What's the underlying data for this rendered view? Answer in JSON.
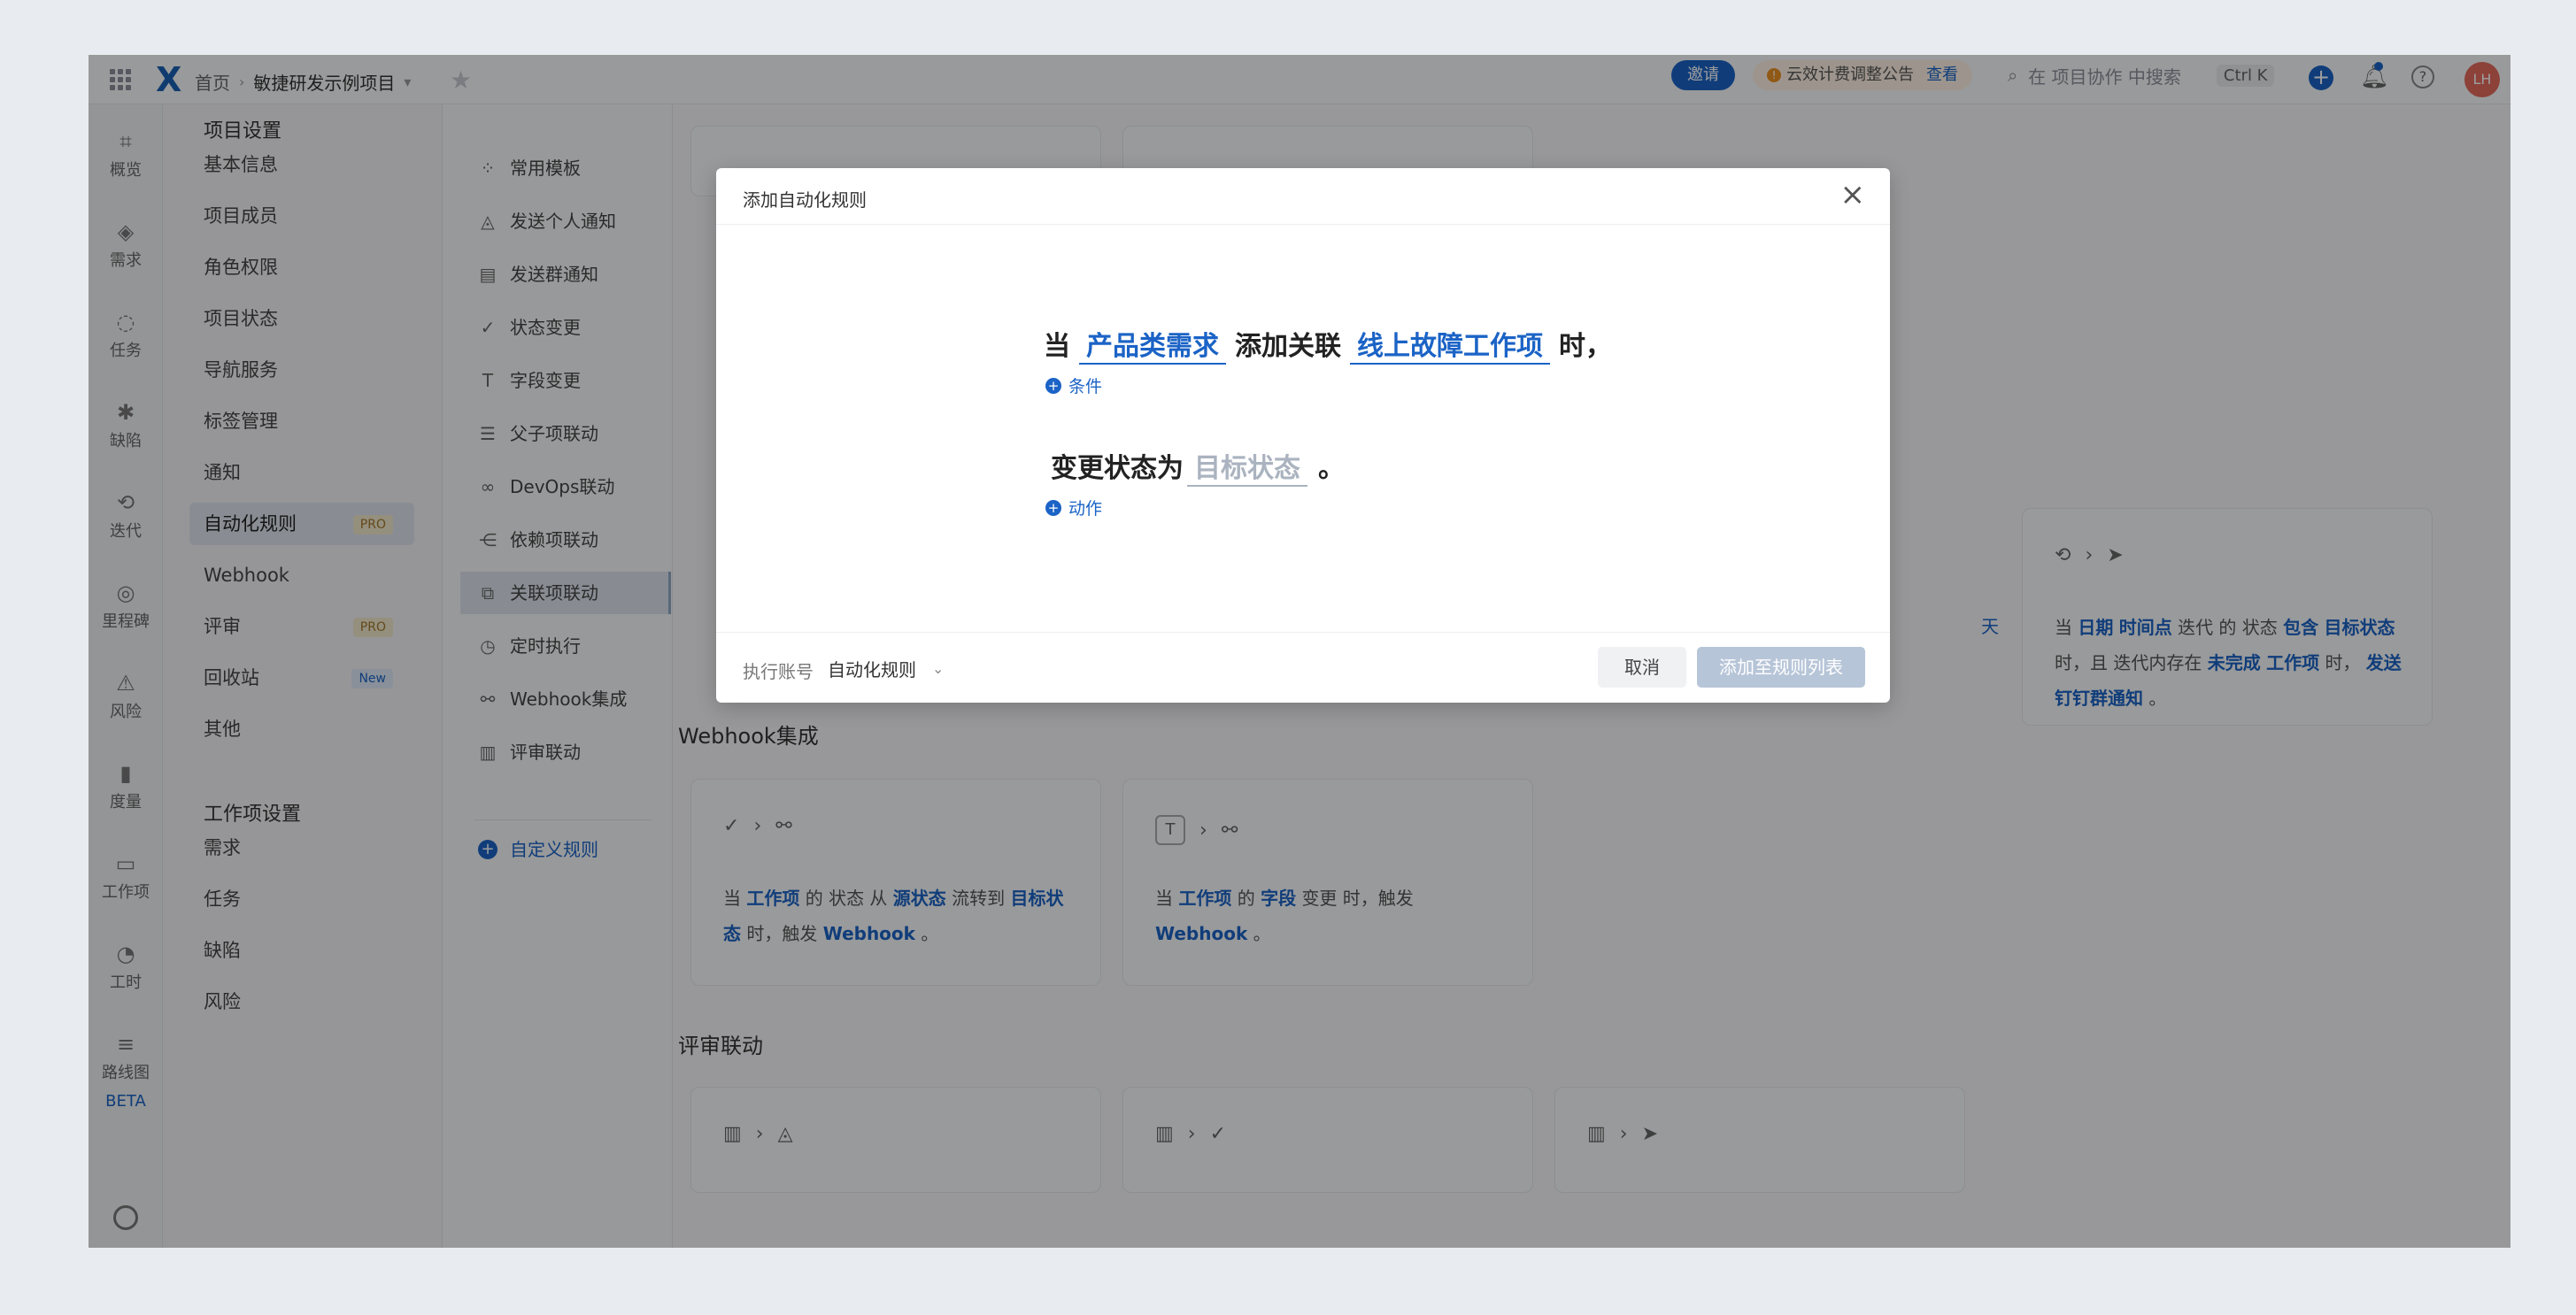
{
  "topbar": {
    "breadcrumb_home": "首页",
    "project_name": "敏捷研发示例项目",
    "invite_label": "邀请",
    "notice_text": "云效计费调整公告",
    "notice_link": "查看",
    "search_placeholder": "在 项目协作 中搜索",
    "shortcut": "Ctrl K",
    "avatar_initials": "LH"
  },
  "nav": {
    "items": [
      "概览",
      "需求",
      "任务",
      "缺陷",
      "迭代",
      "里程碑",
      "风险",
      "度量",
      "工作项",
      "工时",
      "路线图"
    ],
    "beta_label": "BETA"
  },
  "settings_menu": {
    "project_settings_title": "项目设置",
    "project_items": [
      "基本信息",
      "项目成员",
      "角色权限",
      "项目状态",
      "导航服务",
      "标签管理",
      "通知",
      "自动化规则",
      "Webhook",
      "评审",
      "回收站",
      "其他"
    ],
    "pro_badge": "PRO",
    "new_badge": "New",
    "workitem_settings_title": "工作项设置",
    "workitem_items": [
      "需求",
      "任务",
      "缺陷",
      "风险"
    ]
  },
  "template_menu": {
    "items": [
      "常用模板",
      "发送个人通知",
      "发送群通知",
      "状态变更",
      "字段变更",
      "父子项联动",
      "DevOps联动",
      "依赖项联动",
      "关联项联动",
      "定时执行",
      "Webhook集成",
      "评审联动"
    ],
    "custom_label": "自定义规则"
  },
  "main": {
    "webhook_section_title": "Webhook集成",
    "review_section_title": "评审联动",
    "partial_text": "天",
    "card_iteration": {
      "t1": "当",
      "b1": "日期",
      "b2": "时间点",
      "t2": "迭代 的 状态",
      "b3": "包含",
      "b4": "目标状态",
      "t3": "时，且 迭代内存在",
      "b5": "未完成",
      "b6": "工作项",
      "t4": "时，",
      "b7": "发送钉钉群通知",
      "t5": "。"
    },
    "card_webhook_status": {
      "t1": "当",
      "b1": "工作项",
      "t2": "的 状态 从",
      "b2": "源状态",
      "t3": "流转到",
      "b3": "目标状态",
      "t4": "时，触发",
      "b4": "Webhook",
      "t5": "。"
    },
    "card_webhook_field": {
      "t1": "当",
      "b1": "工作项",
      "t2": "的",
      "b2": "字段",
      "t3": "变更 时，触发",
      "b3": "Webhook",
      "t4": "。"
    }
  },
  "modal": {
    "title": "添加自动化规则",
    "when": "当",
    "subject": "产品类需求",
    "action_word": "添加关联",
    "object": "线上故障工作项",
    "time_suffix": "时，",
    "condition_link": "条件",
    "change_prefix": "变更状态为",
    "target_placeholder": "目标状态",
    "period": "。",
    "action_link": "动作",
    "exec_label": "执行账号",
    "exec_value": "自动化规则",
    "cancel_label": "取消",
    "add_label": "添加至规则列表"
  }
}
